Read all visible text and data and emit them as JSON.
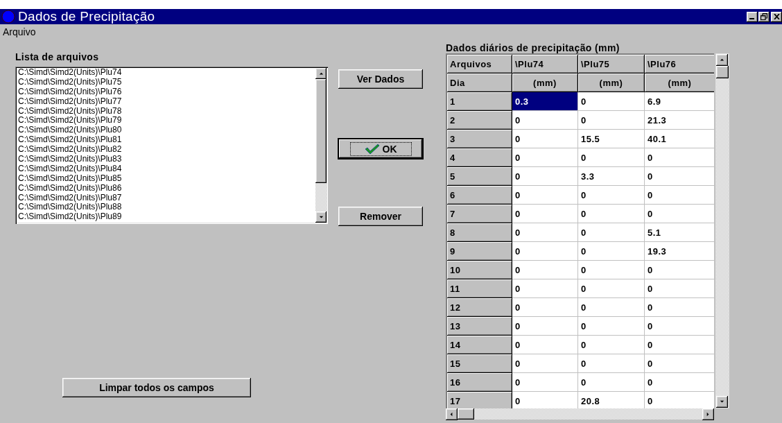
{
  "window": {
    "title": "Dados de Precipitação"
  },
  "menu": [
    "Arquivo"
  ],
  "file_list": {
    "label": "Lista de arquivos",
    "items": [
      {
        "text": "C:\\Simd\\Simd2(Units)\\Plu74",
        "selected": false
      },
      {
        "text": "C:\\Simd\\Simd2(Units)\\Plu75",
        "selected": false
      },
      {
        "text": "C:\\Simd\\Simd2(Units)\\Plu76",
        "selected": false
      },
      {
        "text": "C:\\Simd\\Simd2(Units)\\Plu77",
        "selected": false
      },
      {
        "text": "C:\\Simd\\Simd2(Units)\\Plu78",
        "selected": false
      },
      {
        "text": "C:\\Simd\\Simd2(Units)\\Plu79",
        "selected": false
      },
      {
        "text": "C:\\Simd\\Simd2(Units)\\Plu80",
        "selected": false
      },
      {
        "text": "C:\\Simd\\Simd2(Units)\\Plu81",
        "selected": false
      },
      {
        "text": "C:\\Simd\\Simd2(Units)\\Plu82",
        "selected": false
      },
      {
        "text": "C:\\Simd\\Simd2(Units)\\Plu83",
        "selected": false
      },
      {
        "text": "C:\\Simd\\Simd2(Units)\\Plu84",
        "selected": false
      },
      {
        "text": "C:\\Simd\\Simd2(Units)\\Plu85",
        "selected": false
      },
      {
        "text": "C:\\Simd\\Simd2(Units)\\Plu86",
        "selected": false
      },
      {
        "text": "C:\\Simd\\Simd2(Units)\\Plu87",
        "selected": false
      },
      {
        "text": "C:\\Simd\\Simd2(Units)\\Plu88",
        "selected": false
      },
      {
        "text": "C:\\Simd\\Simd2(Units)\\Plu89",
        "selected": false
      }
    ]
  },
  "buttons": [
    {
      "kind": "plain",
      "label": "Ver Dados",
      "focused": false
    },
    {
      "kind": "ok",
      "label": "OK",
      "focused": true
    },
    {
      "kind": "plain",
      "label": "Remover",
      "focused": false
    }
  ],
  "clear_button": {
    "label": "Limpar todos os campos"
  },
  "grid": {
    "title": "Dados diários de precipitação (mm)",
    "header_rows": [
      [
        "Arquivos",
        "\\Plu74",
        "\\Plu75",
        "\\Plu76"
      ],
      [
        "Dia",
        "(mm)",
        "(mm)",
        "(mm)"
      ]
    ],
    "rows": [
      {
        "day": "1",
        "cells": [
          {
            "text": "0.3",
            "selected": true
          },
          {
            "text": "0",
            "selected": false
          },
          {
            "text": "6.9",
            "selected": false
          }
        ]
      },
      {
        "day": "2",
        "cells": [
          {
            "text": "0",
            "selected": false
          },
          {
            "text": "0",
            "selected": false
          },
          {
            "text": "21.3",
            "selected": false
          }
        ]
      },
      {
        "day": "3",
        "cells": [
          {
            "text": "0",
            "selected": false
          },
          {
            "text": "15.5",
            "selected": false
          },
          {
            "text": "40.1",
            "selected": false
          }
        ]
      },
      {
        "day": "4",
        "cells": [
          {
            "text": "0",
            "selected": false
          },
          {
            "text": "0",
            "selected": false
          },
          {
            "text": "0",
            "selected": false
          }
        ]
      },
      {
        "day": "5",
        "cells": [
          {
            "text": "0",
            "selected": false
          },
          {
            "text": "3.3",
            "selected": false
          },
          {
            "text": "0",
            "selected": false
          }
        ]
      },
      {
        "day": "6",
        "cells": [
          {
            "text": "0",
            "selected": false
          },
          {
            "text": "0",
            "selected": false
          },
          {
            "text": "0",
            "selected": false
          }
        ]
      },
      {
        "day": "7",
        "cells": [
          {
            "text": "0",
            "selected": false
          },
          {
            "text": "0",
            "selected": false
          },
          {
            "text": "0",
            "selected": false
          }
        ]
      },
      {
        "day": "8",
        "cells": [
          {
            "text": "0",
            "selected": false
          },
          {
            "text": "0",
            "selected": false
          },
          {
            "text": "5.1",
            "selected": false
          }
        ]
      },
      {
        "day": "9",
        "cells": [
          {
            "text": "0",
            "selected": false
          },
          {
            "text": "0",
            "selected": false
          },
          {
            "text": "19.3",
            "selected": false
          }
        ]
      },
      {
        "day": "10",
        "cells": [
          {
            "text": "0",
            "selected": false
          },
          {
            "text": "0",
            "selected": false
          },
          {
            "text": "0",
            "selected": false
          }
        ]
      },
      {
        "day": "11",
        "cells": [
          {
            "text": "0",
            "selected": false
          },
          {
            "text": "0",
            "selected": false
          },
          {
            "text": "0",
            "selected": false
          }
        ]
      },
      {
        "day": "12",
        "cells": [
          {
            "text": "0",
            "selected": false
          },
          {
            "text": "0",
            "selected": false
          },
          {
            "text": "0",
            "selected": false
          }
        ]
      },
      {
        "day": "13",
        "cells": [
          {
            "text": "0",
            "selected": false
          },
          {
            "text": "0",
            "selected": false
          },
          {
            "text": "0",
            "selected": false
          }
        ]
      },
      {
        "day": "14",
        "cells": [
          {
            "text": "0",
            "selected": false
          },
          {
            "text": "0",
            "selected": false
          },
          {
            "text": "0",
            "selected": false
          }
        ]
      },
      {
        "day": "15",
        "cells": [
          {
            "text": "0",
            "selected": false
          },
          {
            "text": "0",
            "selected": false
          },
          {
            "text": "0",
            "selected": false
          }
        ]
      },
      {
        "day": "16",
        "cells": [
          {
            "text": "0",
            "selected": false
          },
          {
            "text": "0",
            "selected": false
          },
          {
            "text": "0",
            "selected": false
          }
        ]
      },
      {
        "day": "17",
        "cells": [
          {
            "text": "0",
            "selected": false
          },
          {
            "text": "20.8",
            "selected": false
          },
          {
            "text": "0",
            "selected": false
          }
        ]
      }
    ]
  }
}
